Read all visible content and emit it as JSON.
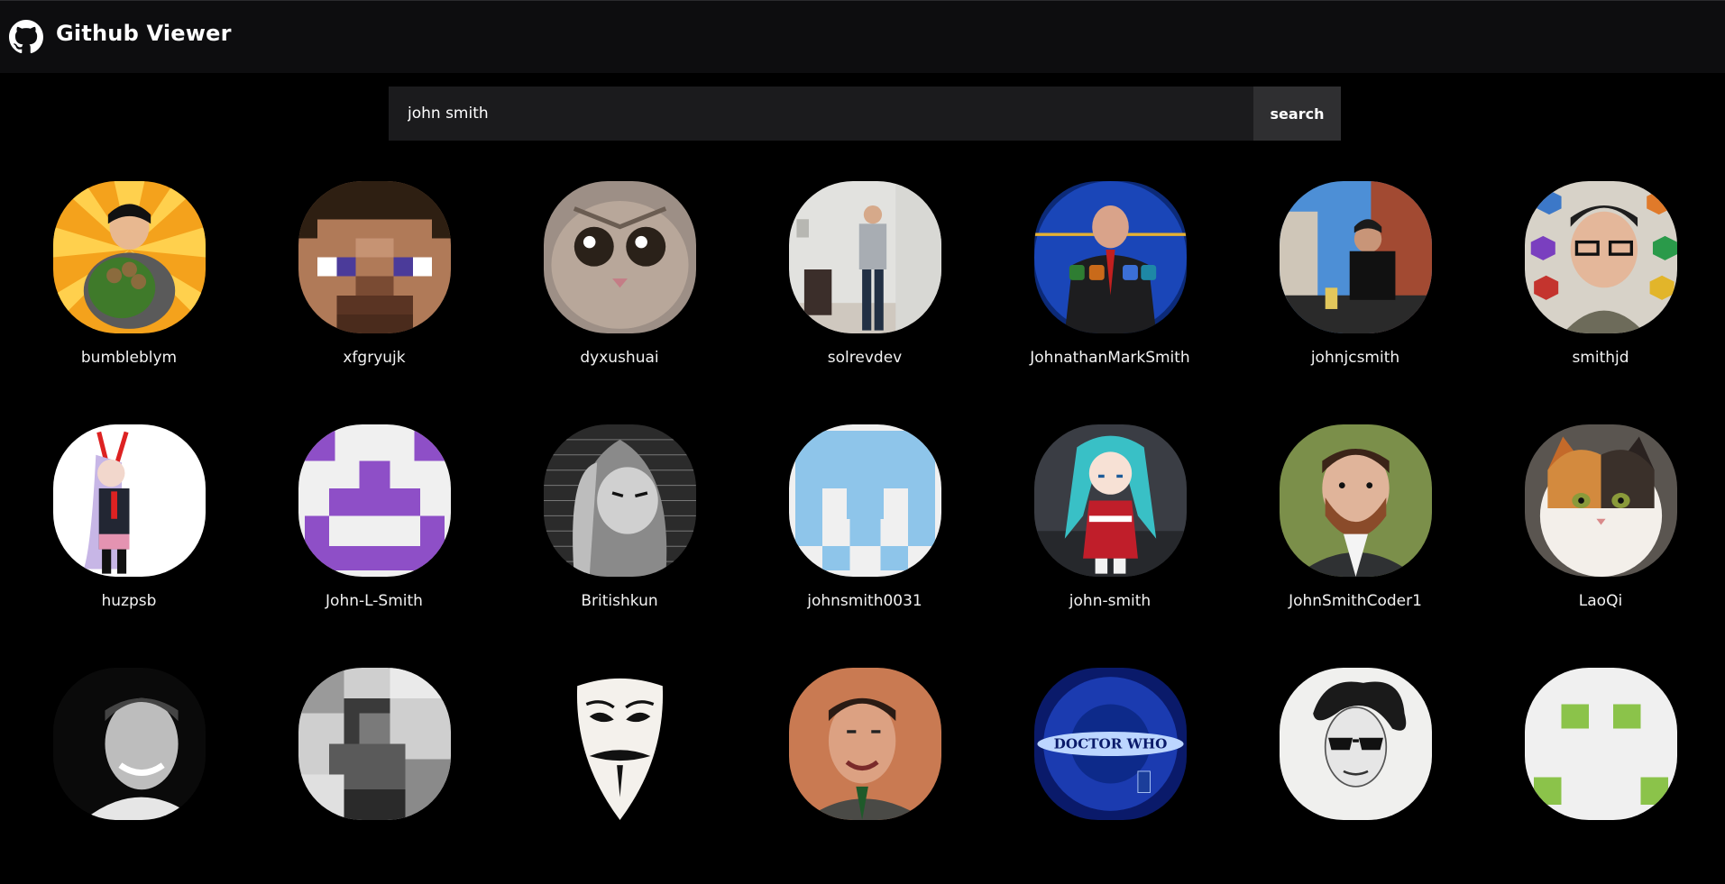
{
  "header": {
    "title": "Github Viewer",
    "logo_icon": "github-icon"
  },
  "search": {
    "value": "john smith",
    "button_label": "search"
  },
  "users": [
    {
      "login": "bumbleblym"
    },
    {
      "login": "xfgryujk"
    },
    {
      "login": "dyxushuai"
    },
    {
      "login": "solrevdev"
    },
    {
      "login": "JohnathanMarkSmith"
    },
    {
      "login": "johnjcsmith"
    },
    {
      "login": "smithjd"
    },
    {
      "login": "huzpsb"
    },
    {
      "login": "John-L-Smith"
    },
    {
      "login": "Britishkun"
    },
    {
      "login": "johnsmith0031"
    },
    {
      "login": "john-smith"
    },
    {
      "login": "JohnSmithCoder1"
    },
    {
      "login": "LaoQi"
    },
    {
      "login": ""
    },
    {
      "login": ""
    },
    {
      "login": ""
    },
    {
      "login": ""
    },
    {
      "login": ""
    },
    {
      "login": ""
    },
    {
      "login": ""
    }
  ],
  "colors": {
    "background": "#000000",
    "topbar": "#0d0d0f",
    "input_bg": "#1b1b1d",
    "button_bg": "#2f2f31"
  }
}
